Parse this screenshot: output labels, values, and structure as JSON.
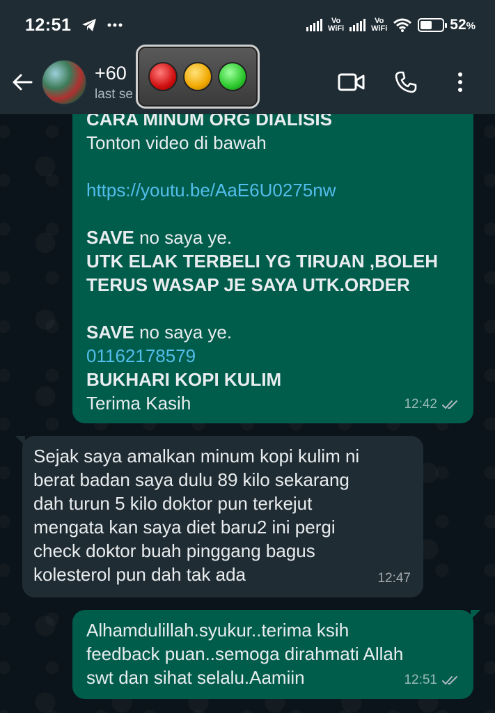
{
  "status_bar": {
    "time": "12:51",
    "indicators": [
      "telegram-icon",
      "more-dots"
    ],
    "vo_label": "Vo",
    "wifi_label": "WiFi",
    "battery_percent": "52",
    "battery_level": 0.52,
    "percent_sign": "%"
  },
  "header": {
    "contact_name": "+60",
    "contact_sub": "last se",
    "actions": [
      "video-call-icon",
      "voice-call-icon",
      "menu-icon"
    ]
  },
  "messages": [
    {
      "direction": "outgoing",
      "lines": [
        {
          "text": "CARA MINUM ORG DIALISIS",
          "style": "bold"
        },
        {
          "text": "Tonton video di bawah",
          "style": "normal"
        },
        {
          "text": "",
          "style": "blank"
        },
        {
          "text": "https://youtu.be/AaE6U0275nw",
          "style": "link"
        },
        {
          "text": "",
          "style": "blank"
        },
        {
          "bold": "SAVE",
          "rest": " no saya ye.",
          "style": "mixed"
        },
        {
          "text": "UTK ELAK TERBELI YG TIRUAN ,BOLEH",
          "style": "bold"
        },
        {
          "text": "TERUS WASAP JE SAYA UTK.ORDER",
          "style": "bold"
        },
        {
          "text": "",
          "style": "blank"
        },
        {
          "bold": "SAVE",
          "rest": " no saya ye.",
          "style": "mixed"
        },
        {
          "text": "01162178579",
          "style": "link"
        },
        {
          "text": "BUKHARI KOPI KULIM",
          "style": "bold"
        },
        {
          "text": "Terima Kasih",
          "style": "normal"
        }
      ],
      "time": "12:42",
      "read": true
    },
    {
      "direction": "incoming",
      "lines": [
        "Sejak saya amalkan minum kopi kulim ni",
        "berat badan saya dulu 89 kilo sekarang",
        "dah turun 5 kilo doktor pun terkejut",
        "mengata kan saya diet baru2 ini pergi",
        "check doktor buah pinggang bagus",
        "kolesterol pun dah tak ada"
      ],
      "time": "12:47"
    },
    {
      "direction": "outgoing",
      "lines": [
        "Alhamdulillah.syukur..terima ksih",
        "feedback puan..semoga dirahmati Allah",
        "swt dan sihat selalu.Aamiin"
      ],
      "time": "12:51",
      "read": true
    }
  ],
  "colors": {
    "background": "#0b141a",
    "bar": "#1f2c34",
    "outgoing_bubble": "#005c4b",
    "incoming_bubble": "#202c33",
    "link": "#53bdeb",
    "read_ticks": "#aebac1"
  }
}
